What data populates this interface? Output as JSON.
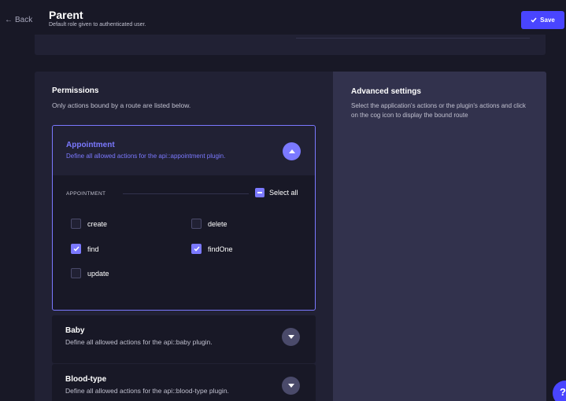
{
  "header": {
    "back_label": "Back",
    "title": "Parent",
    "subtitle": "Default role given to authenticated user.",
    "save_label": "Save"
  },
  "permissions": {
    "title": "Permissions",
    "description": "Only actions bound by a route are listed below.",
    "accordions": [
      {
        "title": "Appointment",
        "description": "Define all allowed actions for the api::appointment plugin.",
        "expanded": true,
        "section_label": "APPOINTMENT",
        "select_all_label": "Select all",
        "actions": [
          {
            "label": "create",
            "checked": false
          },
          {
            "label": "delete",
            "checked": false
          },
          {
            "label": "find",
            "checked": true
          },
          {
            "label": "findOne",
            "checked": true
          },
          {
            "label": "update",
            "checked": false
          }
        ]
      },
      {
        "title": "Baby",
        "description": "Define all allowed actions for the api::baby plugin.",
        "expanded": false
      },
      {
        "title": "Blood-type",
        "description": "Define all allowed actions for the api::blood-type plugin.",
        "expanded": false
      }
    ]
  },
  "advanced": {
    "title": "Advanced settings",
    "description": "Select the application's actions or the plugin's actions and click on the cog icon to display the bound route"
  },
  "help": {
    "label": "?"
  },
  "colors": {
    "background": "#181826",
    "panel": "#212134",
    "panel_light": "#32324d",
    "accent": "#7b79ff",
    "primary": "#4945ff"
  }
}
